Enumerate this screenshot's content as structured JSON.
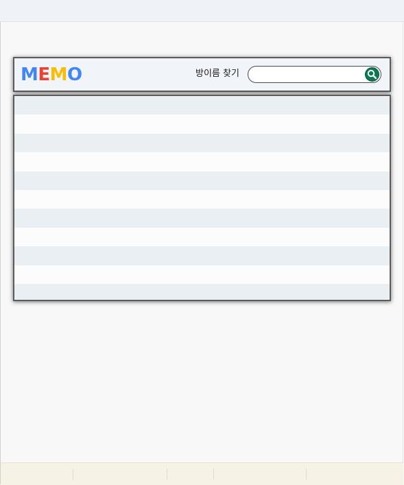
{
  "header": {
    "logo": {
      "letters": [
        "M",
        "E",
        "M",
        "O"
      ],
      "colors": [
        "#4285f4",
        "#ea4335",
        "#fbbc05",
        "#4285f4"
      ]
    },
    "search_label": "방이름 찾기",
    "search_placeholder": "",
    "search_value": "",
    "search_button_icon": "search-icon",
    "search_button_color": "#0b7a52"
  },
  "memo_list": {
    "row_count": 11,
    "rows": [
      "",
      "",
      "",
      "",
      "",
      "",
      "",
      "",
      "",
      "",
      ""
    ],
    "stripe_color": "#e9eff2"
  },
  "bottom_bar": {
    "segments": 5
  }
}
